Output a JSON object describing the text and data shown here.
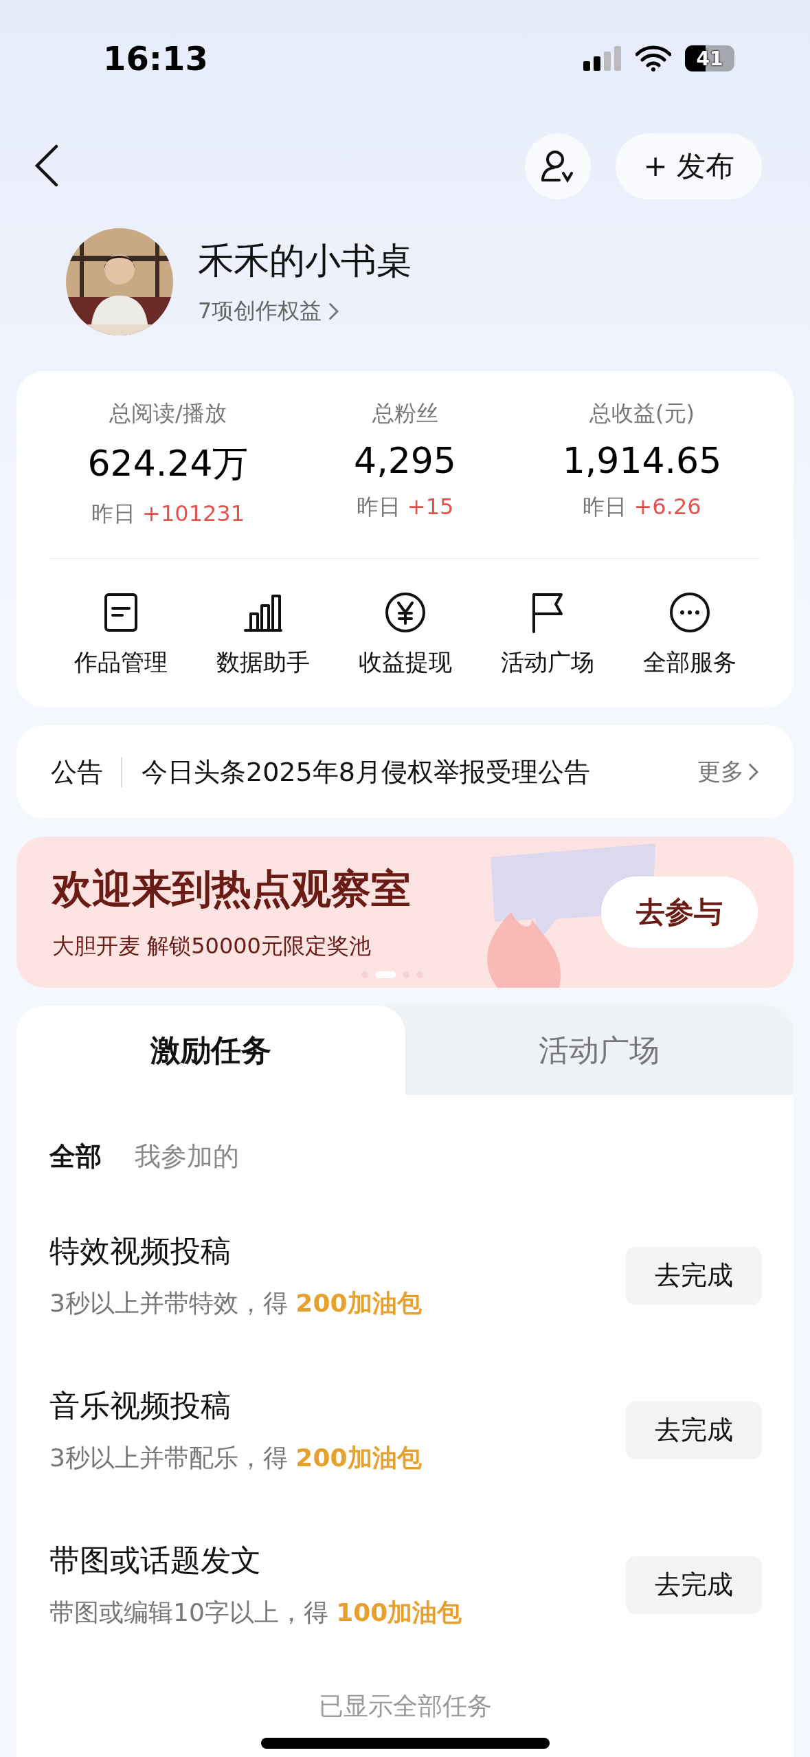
{
  "status_bar": {
    "time": "16:13",
    "battery": "41"
  },
  "nav": {
    "publish_label": "+ 发布"
  },
  "profile": {
    "name": "禾禾的小书桌",
    "subtitle": "7项创作权益"
  },
  "stats": [
    {
      "label": "总阅读/播放",
      "value": "624.24万",
      "delta_label": "昨日",
      "delta": "+101231"
    },
    {
      "label": "总粉丝",
      "value": "4,295",
      "delta_label": "昨日",
      "delta": "+15"
    },
    {
      "label": "总收益(元)",
      "value": "1,914.65",
      "delta_label": "昨日",
      "delta": "+6.26"
    }
  ],
  "services": [
    {
      "kind": "document",
      "label": "作品管理"
    },
    {
      "kind": "chart",
      "label": "数据助手"
    },
    {
      "kind": "yuan",
      "label": "收益提现"
    },
    {
      "kind": "flag",
      "label": "活动广场"
    },
    {
      "kind": "more",
      "label": "全部服务"
    }
  ],
  "notice": {
    "tag": "公告",
    "text": "今日头条2025年8月侵权举报受理公告",
    "more": "更多"
  },
  "banner": {
    "title": "欢迎来到热点观察室",
    "subtitle": "大胆开麦 解锁50000元限定奖池",
    "button": "去参与",
    "pages": [
      {
        "selected": false
      },
      {
        "selected": true
      },
      {
        "selected": false
      },
      {
        "selected": false
      }
    ]
  },
  "task_tabs": [
    {
      "label": "激励任务",
      "selected": true
    },
    {
      "label": "活动广场",
      "selected": false
    }
  ],
  "filters": [
    {
      "label": "全部",
      "selected": true
    },
    {
      "label": "我参加的",
      "selected": false
    }
  ],
  "tasks": [
    {
      "title": "特效视频投稿",
      "desc": "3秒以上并带特效，得 **200加油包**",
      "button": "去完成"
    },
    {
      "title": "音乐视频投稿",
      "desc": "3秒以上并带配乐，得 **200加油包**",
      "button": "去完成"
    },
    {
      "title": "带图或话题发文",
      "desc": "带图或编辑10字以上，得 **100加油包**",
      "button": "去完成"
    }
  ],
  "footer": "已显示全部任务"
}
